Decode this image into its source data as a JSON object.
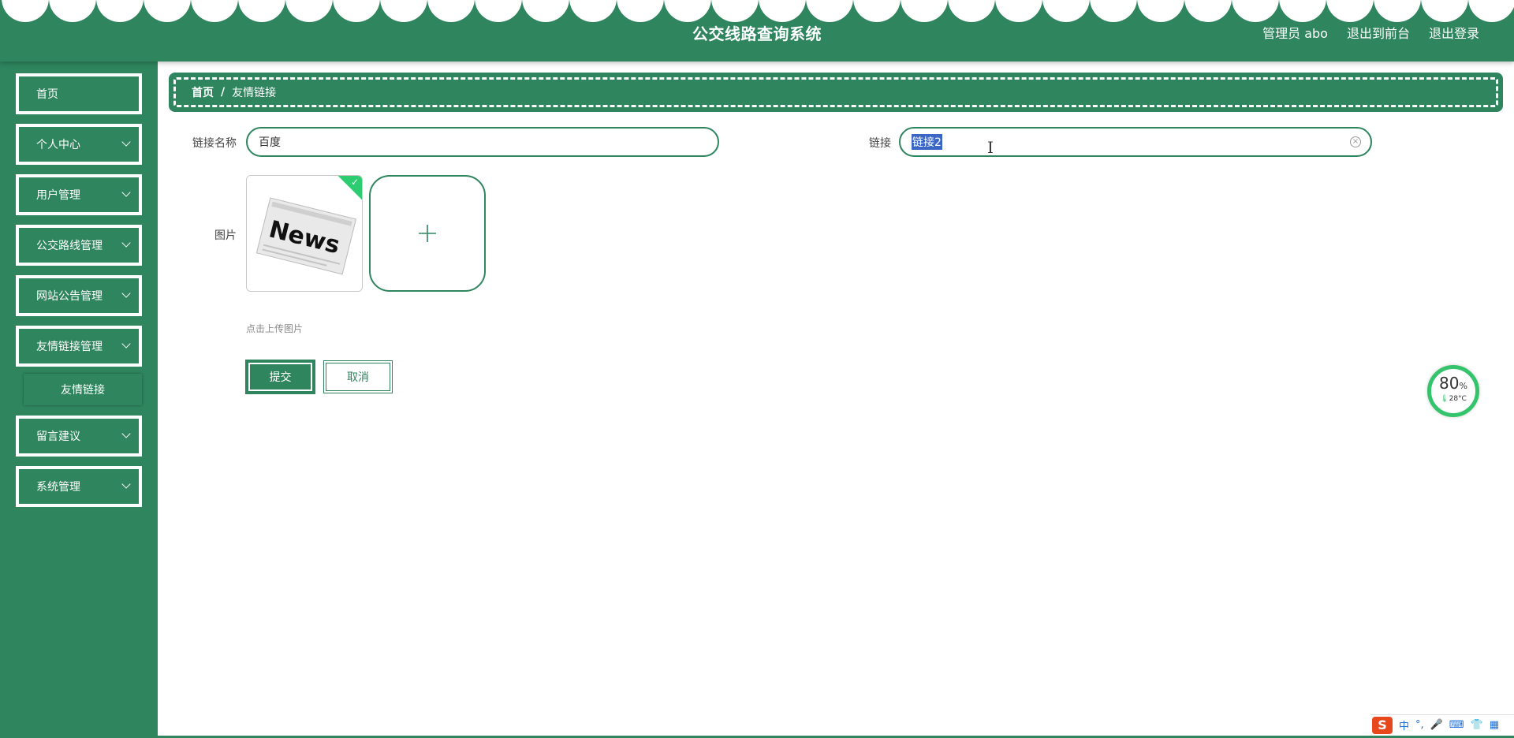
{
  "header": {
    "title": "公交线路查询系统",
    "links": [
      "管理员 abo",
      "退出到前台",
      "退出登录"
    ]
  },
  "sidebar": {
    "items": [
      {
        "label": "首页"
      },
      {
        "label": "个人中心"
      },
      {
        "label": "用户管理"
      },
      {
        "label": "公交路线管理"
      },
      {
        "label": "网站公告管理"
      },
      {
        "label": "友情链接管理"
      },
      {
        "label": "留言建议"
      },
      {
        "label": "系统管理"
      }
    ],
    "sub_item": "友情链接"
  },
  "breadcrumb": {
    "home": "首页",
    "separator": "/",
    "current": "友情链接"
  },
  "form": {
    "name_label": "链接名称",
    "name_value": "百度",
    "link_label": "链接",
    "link_value": "链接2",
    "image_label": "图片",
    "image_text": "News",
    "upload_hint": "点击上传图片",
    "submit_label": "提交",
    "cancel_label": "取消"
  },
  "widget": {
    "percent": "80",
    "percent_unit": "%",
    "temperature": "28°C"
  },
  "ime": {
    "logo": "S",
    "items": [
      "中",
      "°,",
      "🎤",
      "⌨",
      "👕",
      "▦"
    ]
  },
  "colors": {
    "primary": "#2e855e",
    "accent_green": "#34c46b",
    "selection": "#3a66c5"
  },
  "icons": {
    "chevron": "chevron-down-icon",
    "plus": "plus-icon",
    "clear": "clear-icon",
    "check": "check-icon"
  }
}
